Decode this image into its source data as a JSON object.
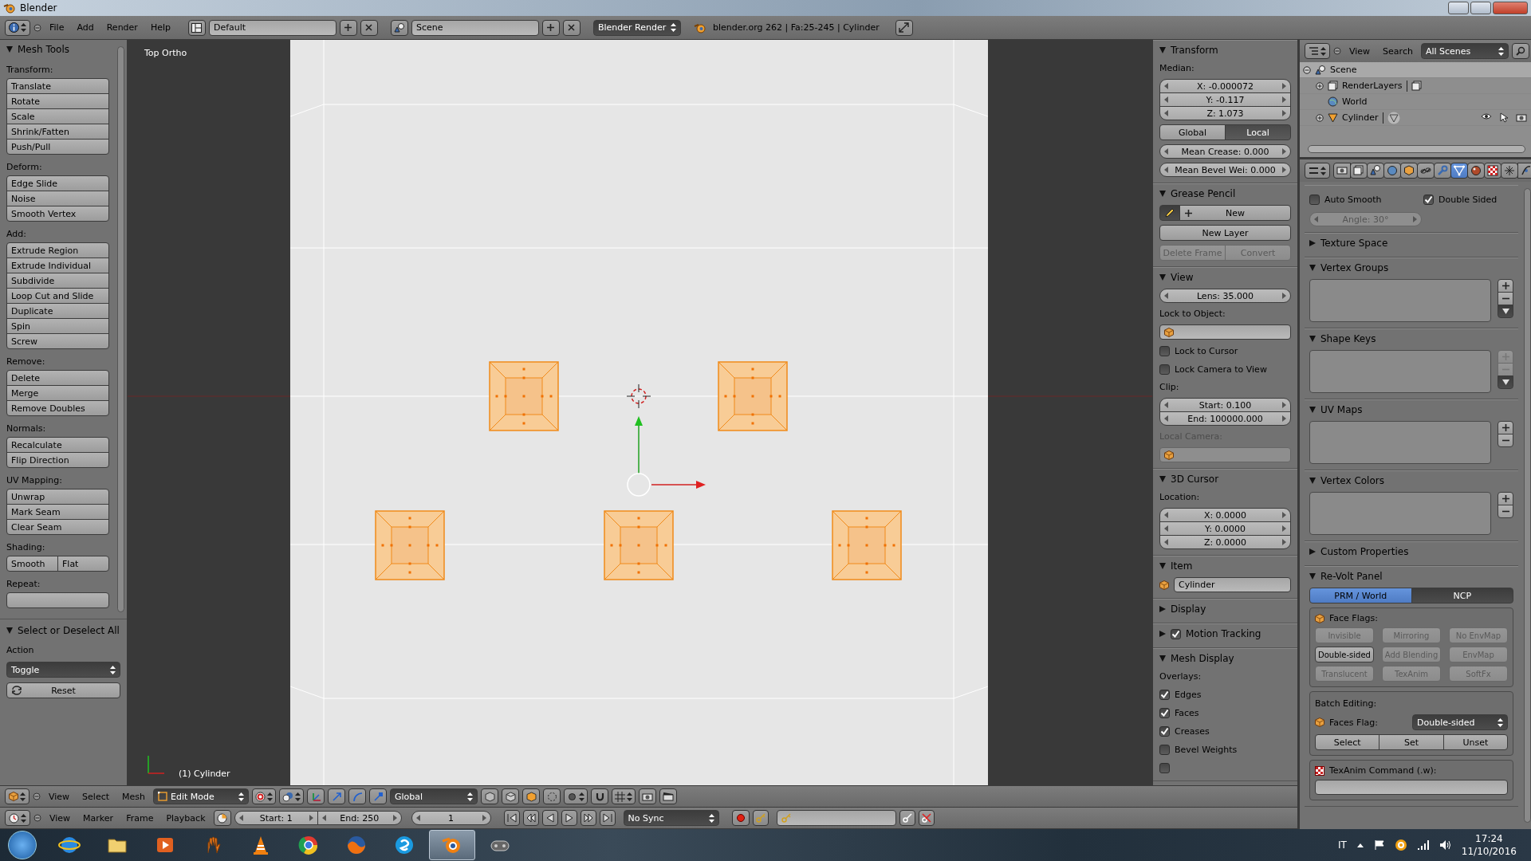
{
  "window": {
    "title": "Blender"
  },
  "info_header": {
    "menus": [
      "File",
      "Add",
      "Render",
      "Help"
    ],
    "layout": "Default",
    "scene": "Scene",
    "engine": "Blender Render",
    "stats": "blender.org 262 | Fa:25-245 | Cylinder"
  },
  "tool_shelf": {
    "title": "Mesh Tools",
    "expanded": true,
    "groups": [
      {
        "label": "Transform:",
        "kind": "column",
        "buttons": [
          "Translate",
          "Rotate",
          "Scale",
          "Shrink/Fatten",
          "Push/Pull"
        ]
      },
      {
        "label": "Deform:",
        "kind": "column",
        "buttons": [
          "Edge Slide",
          "Noise",
          "Smooth Vertex"
        ]
      },
      {
        "label": "Add:",
        "kind": "column",
        "buttons": [
          "Extrude Region",
          "Extrude Individual",
          "Subdivide",
          "Loop Cut and Slide",
          "Duplicate",
          "Spin",
          "Screw"
        ]
      },
      {
        "label": "Remove:",
        "kind": "column",
        "buttons": [
          "Delete",
          "Merge",
          "Remove Doubles"
        ]
      },
      {
        "label": "Normals:",
        "kind": "column",
        "buttons": [
          "Recalculate",
          "Flip Direction"
        ]
      },
      {
        "label": "UV Mapping:",
        "kind": "column",
        "buttons": [
          "Unwrap",
          "Mark Seam",
          "Clear Seam"
        ]
      },
      {
        "label": "Shading:",
        "kind": "row",
        "buttons": [
          "Smooth",
          "Flat"
        ]
      },
      {
        "label": "Repeat:",
        "kind": "clipped"
      }
    ],
    "operator": {
      "title": "Select or Deselect All",
      "expanded": true,
      "action_label": "Action",
      "action": "Toggle",
      "reset": "Reset"
    }
  },
  "viewport": {
    "view_name": "Top Ortho",
    "object_label": "(1) Cylinder"
  },
  "n_panel": {
    "panels": [
      {
        "title": "Transform",
        "expanded": true,
        "widgets": [
          {
            "kind": "label",
            "text": "Median:"
          },
          {
            "kind": "numbers",
            "items": [
              "X: -0.000072",
              "Y: -0.117",
              "Z: 1.073"
            ]
          },
          {
            "kind": "toggles",
            "items": [
              {
                "label": "Global",
                "on": false
              },
              {
                "label": "Local",
                "on": true
              }
            ]
          },
          {
            "kind": "numbers",
            "items": [
              "Mean Crease: 0.000"
            ]
          },
          {
            "kind": "numbers",
            "items": [
              "Mean Bevel Wei: 0.000"
            ]
          }
        ]
      },
      {
        "title": "Grease Pencil",
        "expanded": true,
        "widgets": [
          {
            "kind": "pencil_new",
            "label": "New"
          },
          {
            "kind": "buttons",
            "items": [
              {
                "label": "New Layer",
                "disabled": false
              }
            ]
          },
          {
            "kind": "buttons",
            "items": [
              {
                "label": "Delete Frame",
                "disabled": true
              },
              {
                "label": "Convert",
                "disabled": true
              }
            ]
          }
        ]
      },
      {
        "title": "View",
        "expanded": true,
        "widgets": [
          {
            "kind": "numbers",
            "items": [
              "Lens: 35.000"
            ]
          },
          {
            "kind": "label",
            "text": "Lock to Object:"
          },
          {
            "kind": "object_field",
            "disabled": false
          },
          {
            "kind": "checkbox",
            "label": "Lock to Cursor",
            "checked": false
          },
          {
            "kind": "checkbox",
            "label": "Lock Camera to View",
            "checked": false
          },
          {
            "kind": "label",
            "text": "Clip:"
          },
          {
            "kind": "numbers",
            "items": [
              "Start: 0.100",
              "End: 100000.000"
            ]
          },
          {
            "kind": "label",
            "text": "Local Camera:",
            "disabled": true
          },
          {
            "kind": "object_field",
            "disabled": true
          }
        ]
      },
      {
        "title": "3D Cursor",
        "expanded": true,
        "widgets": [
          {
            "kind": "label",
            "text": "Location:"
          },
          {
            "kind": "numbers",
            "items": [
              "X: 0.0000",
              "Y: 0.0000",
              "Z: 0.0000"
            ]
          }
        ]
      },
      {
        "title": "Item",
        "expanded": true,
        "widgets": [
          {
            "kind": "name_field",
            "text": "Cylinder"
          }
        ]
      },
      {
        "title": "Display",
        "expanded": false
      },
      {
        "title": "Motion Tracking",
        "expanded": false,
        "checked": true
      },
      {
        "title": "Mesh Display",
        "expanded": true,
        "widgets": [
          {
            "kind": "label",
            "text": "Overlays:"
          },
          {
            "kind": "checkbox",
            "label": "Edges",
            "checked": true
          },
          {
            "kind": "checkbox",
            "label": "Faces",
            "checked": true
          },
          {
            "kind": "checkbox",
            "label": "Creases",
            "checked": true
          },
          {
            "kind": "checkbox",
            "label": "Bevel Weights",
            "checked": false
          },
          {
            "kind": "checkbox",
            "checked": false
          }
        ]
      }
    ]
  },
  "outliner": {
    "menus": [
      "View",
      "Search"
    ],
    "filter": "All Scenes",
    "tree": [
      {
        "label": "Scene",
        "kind": "scene",
        "expanded": true,
        "selected": true,
        "children": [
          {
            "label": "RenderLayers",
            "kind": "render_layers",
            "expanded": false,
            "selected": false
          },
          {
            "label": "World",
            "kind": "world",
            "selected": false
          },
          {
            "label": "Cylinder",
            "kind": "mesh_object",
            "expanded": false,
            "selected": false
          }
        ]
      }
    ]
  },
  "properties": {
    "tabs": [
      {
        "kind": "render",
        "selected": false
      },
      {
        "kind": "render_layers",
        "selected": false
      },
      {
        "kind": "scene",
        "selected": false
      },
      {
        "kind": "world",
        "selected": false
      },
      {
        "kind": "object",
        "selected": false
      },
      {
        "kind": "constraints",
        "selected": false
      },
      {
        "kind": "modifiers",
        "selected": false
      },
      {
        "kind": "data",
        "selected": true
      },
      {
        "kind": "material",
        "selected": false
      },
      {
        "kind": "texture",
        "selected": false
      },
      {
        "kind": "particles",
        "selected": false
      },
      {
        "kind": "physics",
        "selected": false
      }
    ],
    "panels": [
      {
        "widgets": [
          {
            "kind": "checkboxes",
            "items": [
              {
                "label": "Auto Smooth",
                "checked": false
              },
              {
                "label": "Double Sided",
                "checked": true
              }
            ]
          },
          {
            "kind": "numbers",
            "items": [
              "Angle: 30°"
            ],
            "disabled": true
          }
        ]
      },
      {
        "title": "Texture Space",
        "expanded": false
      },
      {
        "title": "Vertex Groups",
        "expanded": true,
        "widgets": [
          {
            "kind": "list_box",
            "buttons": [
              {
                "kind": "add",
                "disabled": false
              },
              {
                "kind": "remove",
                "disabled": false
              },
              {
                "kind": "menu",
                "disabled": false
              }
            ]
          }
        ]
      },
      {
        "title": "Shape Keys",
        "expanded": true,
        "widgets": [
          {
            "kind": "list_box",
            "buttons": [
              {
                "kind": "add",
                "disabled": true
              },
              {
                "kind": "remove",
                "disabled": true
              },
              {
                "kind": "menu",
                "disabled": false
              }
            ]
          }
        ]
      },
      {
        "title": "UV Maps",
        "expanded": true,
        "widgets": [
          {
            "kind": "list_box",
            "buttons": [
              {
                "kind": "add",
                "disabled": false
              },
              {
                "kind": "remove",
                "disabled": false
              }
            ]
          }
        ]
      },
      {
        "title": "Vertex Colors",
        "expanded": true,
        "widgets": [
          {
            "kind": "list_box",
            "buttons": [
              {
                "kind": "add",
                "disabled": false
              },
              {
                "kind": "remove",
                "disabled": false
              }
            ]
          }
        ]
      },
      {
        "title": "Custom Properties",
        "expanded": false
      },
      {
        "title": "Re-Volt Panel",
        "expanded": true,
        "widgets": [
          {
            "kind": "segmented",
            "items": [
              {
                "label": "PRM / World",
                "selected": true
              },
              {
                "label": "NCP",
                "selected": false
              }
            ]
          },
          {
            "kind": "box",
            "widgets": [
              {
                "kind": "cube_label",
                "text": "Face Flags:"
              },
              {
                "kind": "grid",
                "items": [
                  {
                    "label": "Invisible",
                    "disabled": true
                  },
                  {
                    "label": "Mirroring",
                    "disabled": true
                  },
                  {
                    "label": "No EnvMap",
                    "disabled": true
                  },
                  {
                    "label": "Double-sided",
                    "disabled": false
                  },
                  {
                    "label": "Add Blending",
                    "disabled": true
                  },
                  {
                    "label": "EnvMap",
                    "disabled": true
                  },
                  {
                    "label": "Translucent",
                    "disabled": true
                  },
                  {
                    "label": "TexAnim",
                    "disabled": true
                  },
                  {
                    "label": "SoftFx",
                    "disabled": true
                  }
                ]
              }
            ]
          },
          {
            "kind": "box",
            "widgets": [
              {
                "kind": "label",
                "text": "Batch Editing:"
              },
              {
                "kind": "dropdown_row",
                "label": "Faces Flag:",
                "value": "Double-sided"
              },
              {
                "kind": "buttons",
                "items": [
                  {
                    "label": "Select",
                    "disabled": false
                  },
                  {
                    "label": "Set",
                    "disabled": false
                  },
                  {
                    "label": "Unset",
                    "disabled": false
                  }
                ]
              }
            ]
          },
          {
            "kind": "box",
            "widgets": [
              {
                "kind": "checker_label",
                "text": "TexAnim Command (.w):"
              },
              {
                "kind": "text_field"
              }
            ]
          }
        ]
      }
    ]
  },
  "view_header": {
    "menus": [
      "View",
      "Select",
      "Mesh"
    ],
    "mode": "Edit Mode",
    "orientation": "Global"
  },
  "timeline": {
    "menus": [
      "View",
      "Marker",
      "Frame",
      "Playback"
    ],
    "start": "Start: 1",
    "end": "End: 250",
    "frame": "1",
    "sync": "No Sync"
  },
  "taskbar": {
    "apps": [
      {
        "kind": "browser",
        "selected": false
      },
      {
        "kind": "folder",
        "selected": false
      },
      {
        "kind": "media",
        "selected": false
      },
      {
        "kind": "hand",
        "selected": false
      },
      {
        "kind": "cone",
        "selected": false
      },
      {
        "kind": "wheel",
        "selected": false
      },
      {
        "kind": "fox",
        "selected": false
      },
      {
        "kind": "chat",
        "selected": false
      },
      {
        "kind": "blender",
        "selected": true
      },
      {
        "kind": "game",
        "selected": false
      }
    ],
    "language": "IT",
    "time": "17:24",
    "date": "11/10/2016"
  }
}
